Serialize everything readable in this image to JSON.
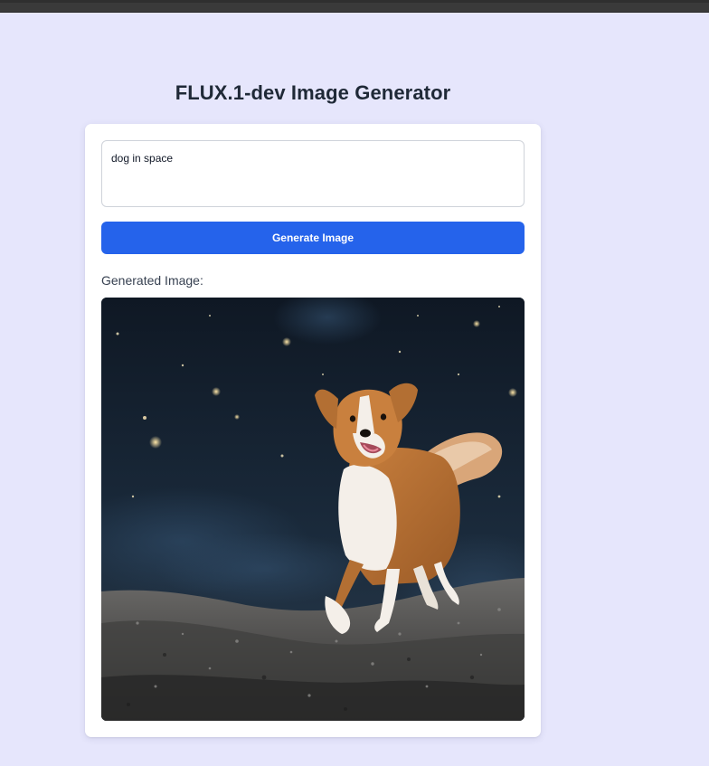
{
  "app": {
    "title": "FLUX.1-dev Image Generator"
  },
  "form": {
    "prompt_value": "dog in space",
    "generate_label": "Generate Image"
  },
  "result": {
    "label": "Generated Image:",
    "image_subject": "dog-in-space"
  },
  "colors": {
    "page_background": "#e6e6fc",
    "button": "#2563eb",
    "title_text": "#1f2937"
  }
}
